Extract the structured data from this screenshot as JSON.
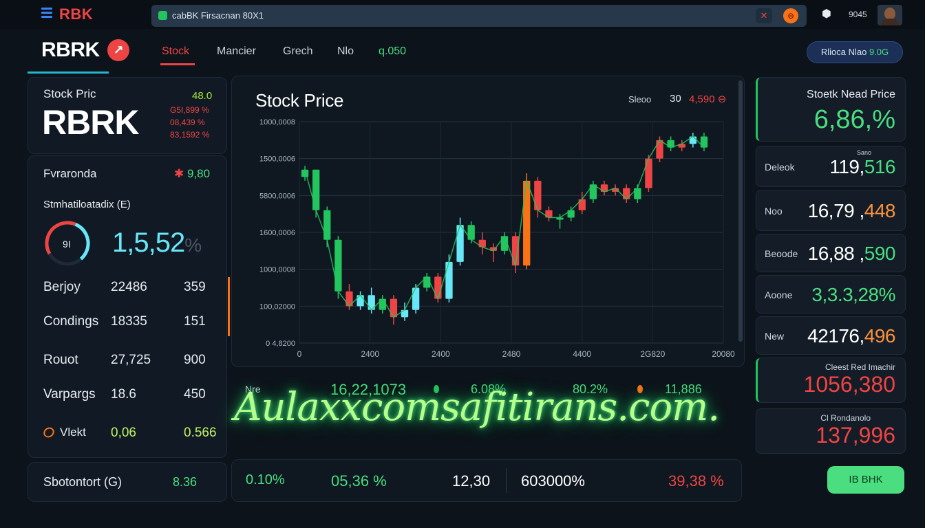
{
  "topbar": {
    "brand": "RBK",
    "address": "cabBK Firsacnan 80X1",
    "addr_btn1": "✕",
    "addr_btn2": "⊖",
    "bell": "⬢",
    "user_text": "9045"
  },
  "nav": {
    "logo": "RBRK",
    "logo_badge": "↗",
    "tabs": [
      "Stock",
      "Mancier",
      "Grech",
      "Nlo",
      "q.050"
    ],
    "pill_label": "Rlioca Nlao",
    "pill_value": "9.0G"
  },
  "stock_panel": {
    "label": "Stock Pric",
    "ticker": "RBRK",
    "v1": "48.0",
    "v2": "G5I,899 %",
    "v3": "08,439 %",
    "v4": "83,1592 %"
  },
  "metrics_panel": {
    "row1_label": "Fvraronda",
    "row1_prefix": "✱",
    "row1_value": "9,80",
    "row2_label": "Stmhatiloatadix (E)",
    "gauge_label": "9I",
    "gauge_level_percent": 72,
    "big_value": "1,5,52",
    "big_suffix": "%",
    "rows": [
      {
        "label": "Berjoy",
        "value": "22486",
        "extra": "359"
      },
      {
        "label": "Condings",
        "value": "18335",
        "extra": "151"
      },
      {
        "label": "Rouot",
        "value": "27,725",
        "extra": "900"
      },
      {
        "label": "Varpargs",
        "value": "18.6",
        "extra": "450"
      },
      {
        "label": "Vlekt",
        "value": "0,06",
        "extra": "0.566"
      }
    ]
  },
  "bottom_left": {
    "label": "Sbotontort (G)",
    "value": "8.36"
  },
  "chart": {
    "title": "Stock Price",
    "hdr_a": "Sleoo",
    "hdr_b": "30",
    "hdr_c": "4,590 ⊖"
  },
  "chart_data": {
    "type": "line",
    "y_ticks": [
      "1000,0008",
      "1500,0006",
      "5800,0006",
      "1600,0006",
      "1000,0008",
      "100,02000",
      "0 4,8200"
    ],
    "x_ticks": [
      "0",
      "2400",
      "2400",
      "2480",
      "4400",
      "2G820",
      "20080"
    ],
    "grid": true,
    "candles": [
      {
        "open": 45,
        "close": 47,
        "high": 48,
        "low": 44
      },
      {
        "open": 47,
        "close": 36,
        "high": 47,
        "low": 34
      },
      {
        "open": 36,
        "close": 28,
        "high": 37,
        "low": 26
      },
      {
        "open": 28,
        "close": 14,
        "high": 29,
        "low": 12
      },
      {
        "open": 14,
        "close": 10,
        "high": 16,
        "low": 9
      },
      {
        "open": 10,
        "close": 13,
        "high": 14,
        "low": 9
      },
      {
        "open": 13,
        "close": 9,
        "high": 15,
        "low": 8
      },
      {
        "open": 9,
        "close": 12,
        "high": 13,
        "low": 8
      },
      {
        "open": 12,
        "close": 7,
        "high": 13,
        "low": 5
      },
      {
        "open": 7,
        "close": 9,
        "high": 11,
        "low": 6
      },
      {
        "open": 9,
        "close": 15,
        "high": 16,
        "low": 8
      },
      {
        "open": 15,
        "close": 18,
        "high": 19,
        "low": 14
      },
      {
        "open": 18,
        "close": 12,
        "high": 19,
        "low": 11
      },
      {
        "open": 12,
        "close": 22,
        "high": 24,
        "low": 11
      },
      {
        "open": 22,
        "close": 32,
        "high": 34,
        "low": 21
      },
      {
        "open": 32,
        "close": 28,
        "high": 33,
        "low": 27
      },
      {
        "open": 28,
        "close": 26,
        "high": 30,
        "low": 24
      },
      {
        "open": 26,
        "close": 25,
        "high": 27,
        "low": 22
      },
      {
        "open": 25,
        "close": 29,
        "high": 30,
        "low": 24
      },
      {
        "open": 29,
        "close": 21,
        "high": 30,
        "low": 19
      },
      {
        "open": 21,
        "close": 44,
        "high": 46,
        "low": 20
      },
      {
        "open": 44,
        "close": 36,
        "high": 45,
        "low": 34
      },
      {
        "open": 36,
        "close": 34,
        "high": 37,
        "low": 33
      },
      {
        "open": 34,
        "close": 34,
        "high": 35,
        "low": 31
      },
      {
        "open": 34,
        "close": 36,
        "high": 37,
        "low": 33
      },
      {
        "open": 36,
        "close": 39,
        "high": 41,
        "low": 35
      },
      {
        "open": 39,
        "close": 43,
        "high": 44,
        "low": 38
      },
      {
        "open": 43,
        "close": 41,
        "high": 44,
        "low": 40
      },
      {
        "open": 41,
        "close": 42,
        "high": 43,
        "low": 40
      },
      {
        "open": 42,
        "close": 39,
        "high": 43,
        "low": 38
      },
      {
        "open": 39,
        "close": 42,
        "high": 43,
        "low": 38
      },
      {
        "open": 42,
        "close": 50,
        "high": 51,
        "low": 41
      },
      {
        "open": 50,
        "close": 55,
        "high": 56,
        "low": 49
      },
      {
        "open": 55,
        "close": 53,
        "high": 56,
        "low": 52
      },
      {
        "open": 53,
        "close": 54,
        "high": 55,
        "low": 52
      },
      {
        "open": 54,
        "close": 56,
        "high": 57,
        "low": 53
      },
      {
        "open": 56,
        "close": 53,
        "high": 57,
        "low": 52
      }
    ],
    "candle_colors": [
      "#22c55e",
      "#22c55e",
      "#22c55e",
      "#22c55e",
      "#ef4444",
      "#67e8f9",
      "#67e8f9",
      "#22c55e",
      "#ef4444",
      "#67e8f9",
      "#67e8f9",
      "#22c55e",
      "#ef4444",
      "#67e8f9",
      "#67e8f9",
      "#22c55e",
      "#ef4444",
      "#ef4444",
      "#22c55e",
      "#ef4444",
      "#f97316",
      "#ef4444",
      "#ef4444",
      "#22c55e",
      "#22c55e",
      "#ef4444",
      "#22c55e",
      "#ef4444",
      "#ef4444",
      "#ef4444",
      "#22c55e",
      "#ef4444",
      "#ef4444",
      "#22c55e",
      "#ef4444",
      "#67e8f9",
      "#22c55e"
    ],
    "y_range": [
      0,
      60
    ]
  },
  "ticker": {
    "label": "Nre",
    "v1": "16,22,1073",
    "v2": "6.08%",
    "v3": "80.2%",
    "v4": "11,886"
  },
  "bottom_mid": {
    "v1": "0.10%",
    "v2": "05,36 %",
    "v3": "12,30",
    "v4": "603000%",
    "v5": "39,38 %"
  },
  "watermark": "Aulaxxcomsafitirans.com.",
  "right": {
    "card0_label": "Stoetk Nead Price",
    "card0_value": "6,86,%",
    "card1_tiny": "Sano",
    "card1_label": "Deleok",
    "card1_value_main": "119,",
    "card1_value_tail": "516",
    "card2_label": "Noo",
    "card2_value_main": "16,79 ,",
    "card2_value_tail": "448",
    "card3_label": "Beoode",
    "card3_value_main": "16,88 ,",
    "card3_value_tail": "590",
    "card4_label": "Aoone",
    "card4_value": "3,3.3,28%",
    "card5_label": "New",
    "card5_value_main": "42176,",
    "card5_value_tail": "496",
    "card6_label": "Cleest Red Imachir",
    "card6_value": "1056,380",
    "card7_label": "Cl Rondanolo",
    "card7_value": "137,996",
    "cta": "IB BHK"
  },
  "colors": {
    "accent_green": "#4ade80",
    "accent_red": "#ef4444",
    "accent_cyan": "#67e8f9",
    "accent_orange": "#f97316",
    "background": "#0d131b"
  }
}
